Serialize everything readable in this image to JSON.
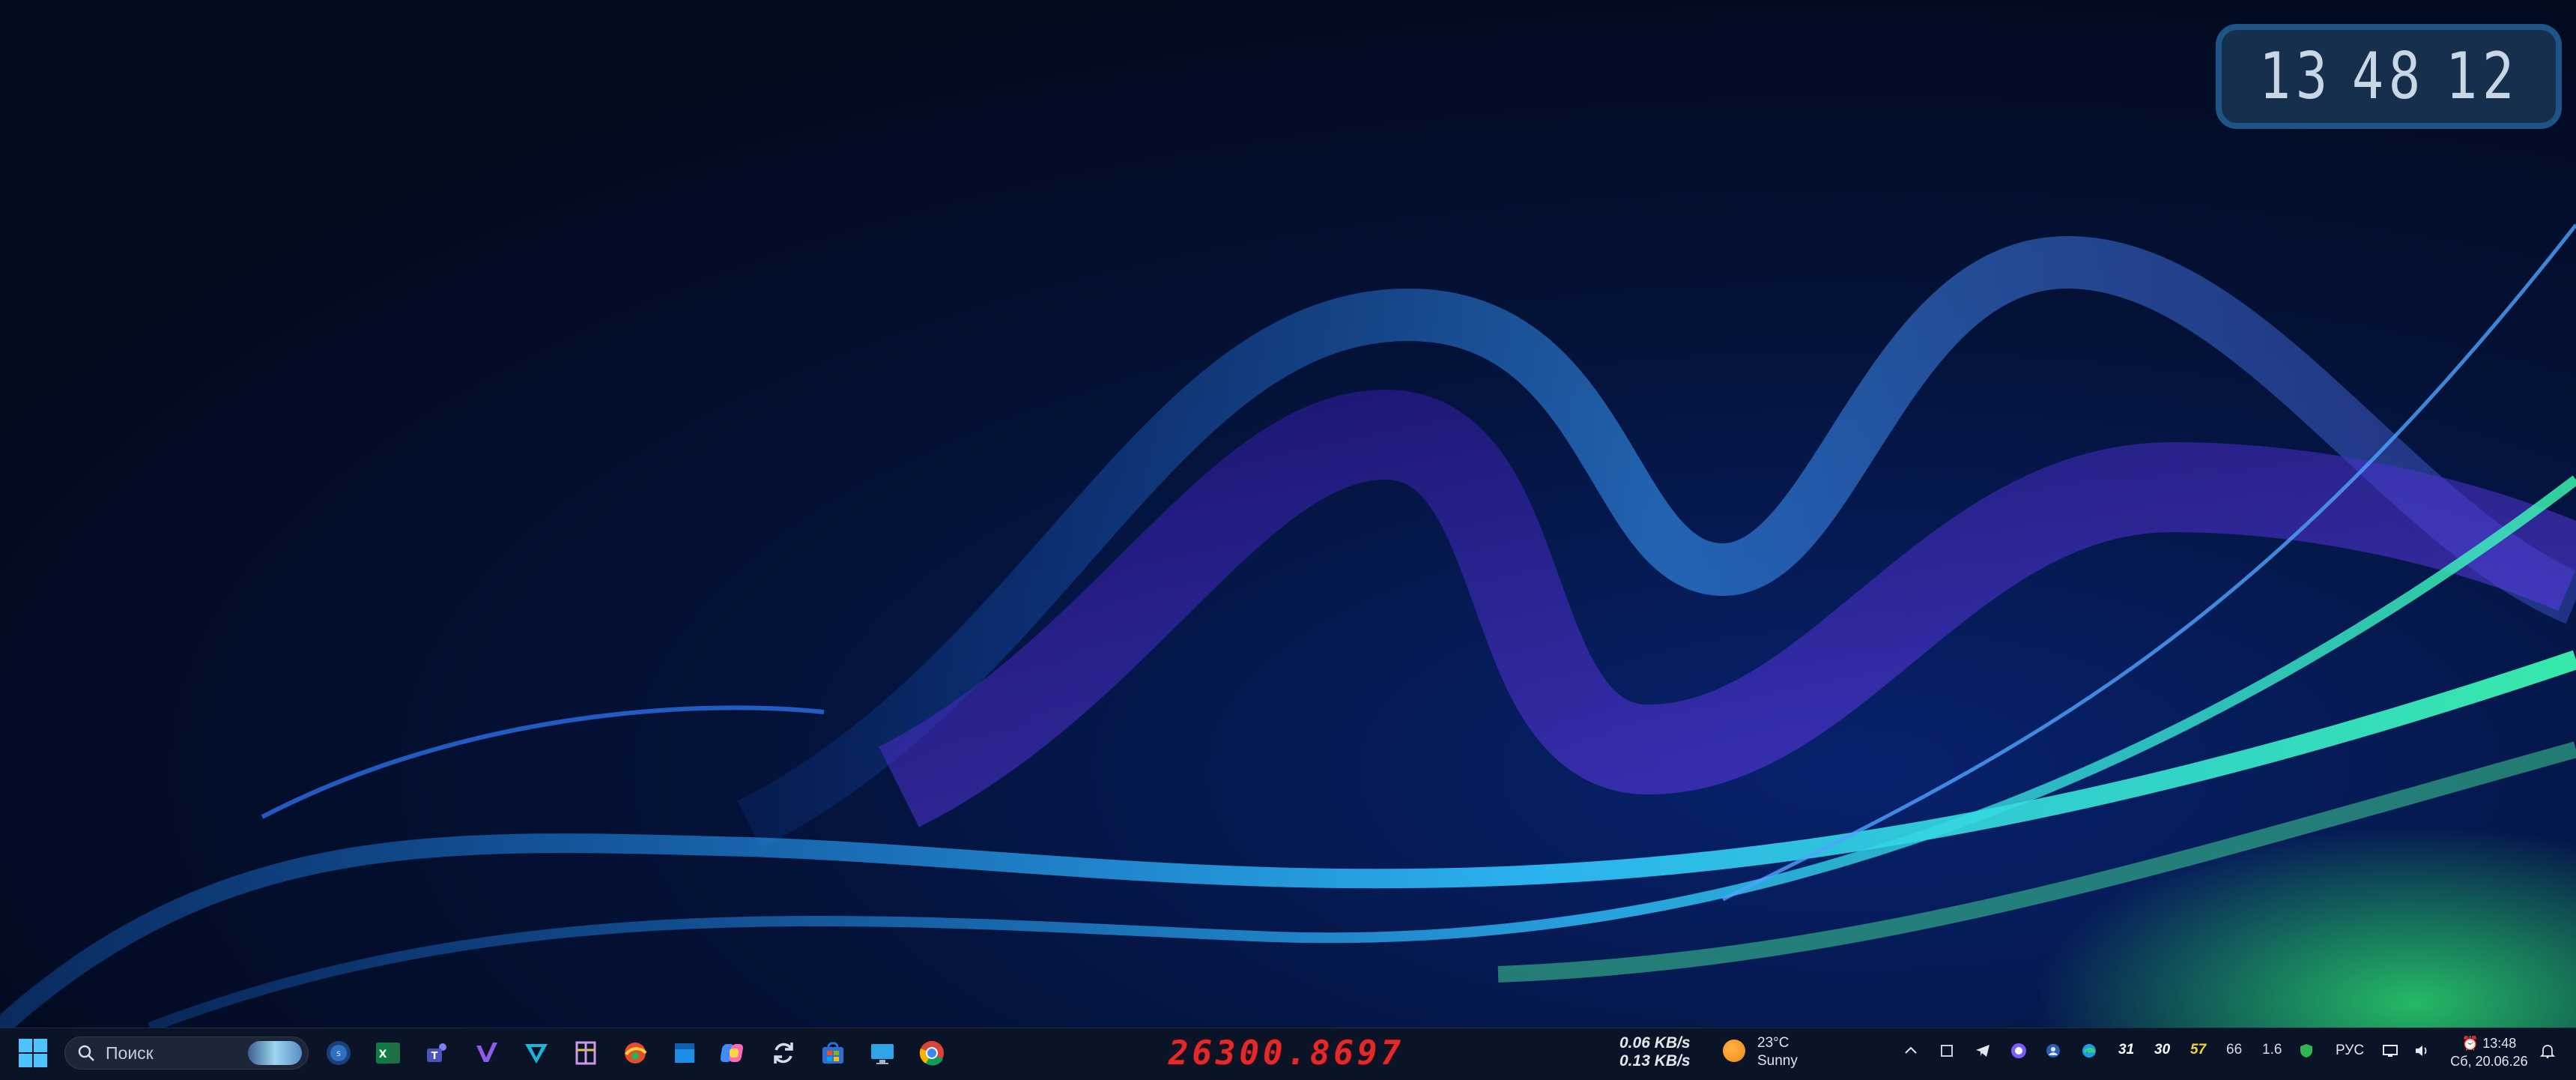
{
  "desktop": {
    "clock": {
      "hours": "13",
      "minutes": "48",
      "seconds": "12"
    }
  },
  "taskbar": {
    "search": {
      "placeholder": "Поиск",
      "icon": "search-icon"
    },
    "pinned_apps": [
      {
        "icon": "steam-icon"
      },
      {
        "icon": "excel-icon"
      },
      {
        "icon": "teams-icon"
      },
      {
        "icon": "visual-studio-icon"
      },
      {
        "icon": "vpn-icon"
      },
      {
        "icon": "tool-icon"
      },
      {
        "icon": "browser-app-icon"
      },
      {
        "icon": "blue-square-app-icon"
      },
      {
        "icon": "copilot-icon"
      },
      {
        "icon": "sync-icon"
      },
      {
        "icon": "store-icon"
      },
      {
        "icon": "monitor-icon"
      },
      {
        "icon": "chrome-icon"
      }
    ],
    "counter_value": "26300.8697",
    "network": {
      "down": "0.06 KB/s",
      "up": "0.13 KB/s"
    },
    "weather": {
      "temperature": "23°C",
      "condition": "Sunny"
    },
    "tray": {
      "stat_1": "31",
      "stat_2": "30",
      "stat_3": "57",
      "stat_4": "66",
      "stat_5": "1.6",
      "language": "РУС"
    },
    "clock": {
      "time": "13:48",
      "date": "Сб, 20.06.26"
    }
  },
  "colors": {
    "counter": "#e12a2a",
    "stat_3": "#f2d23a",
    "taskbar_bg": "#0b1426",
    "clock_border": "#1d5587"
  }
}
